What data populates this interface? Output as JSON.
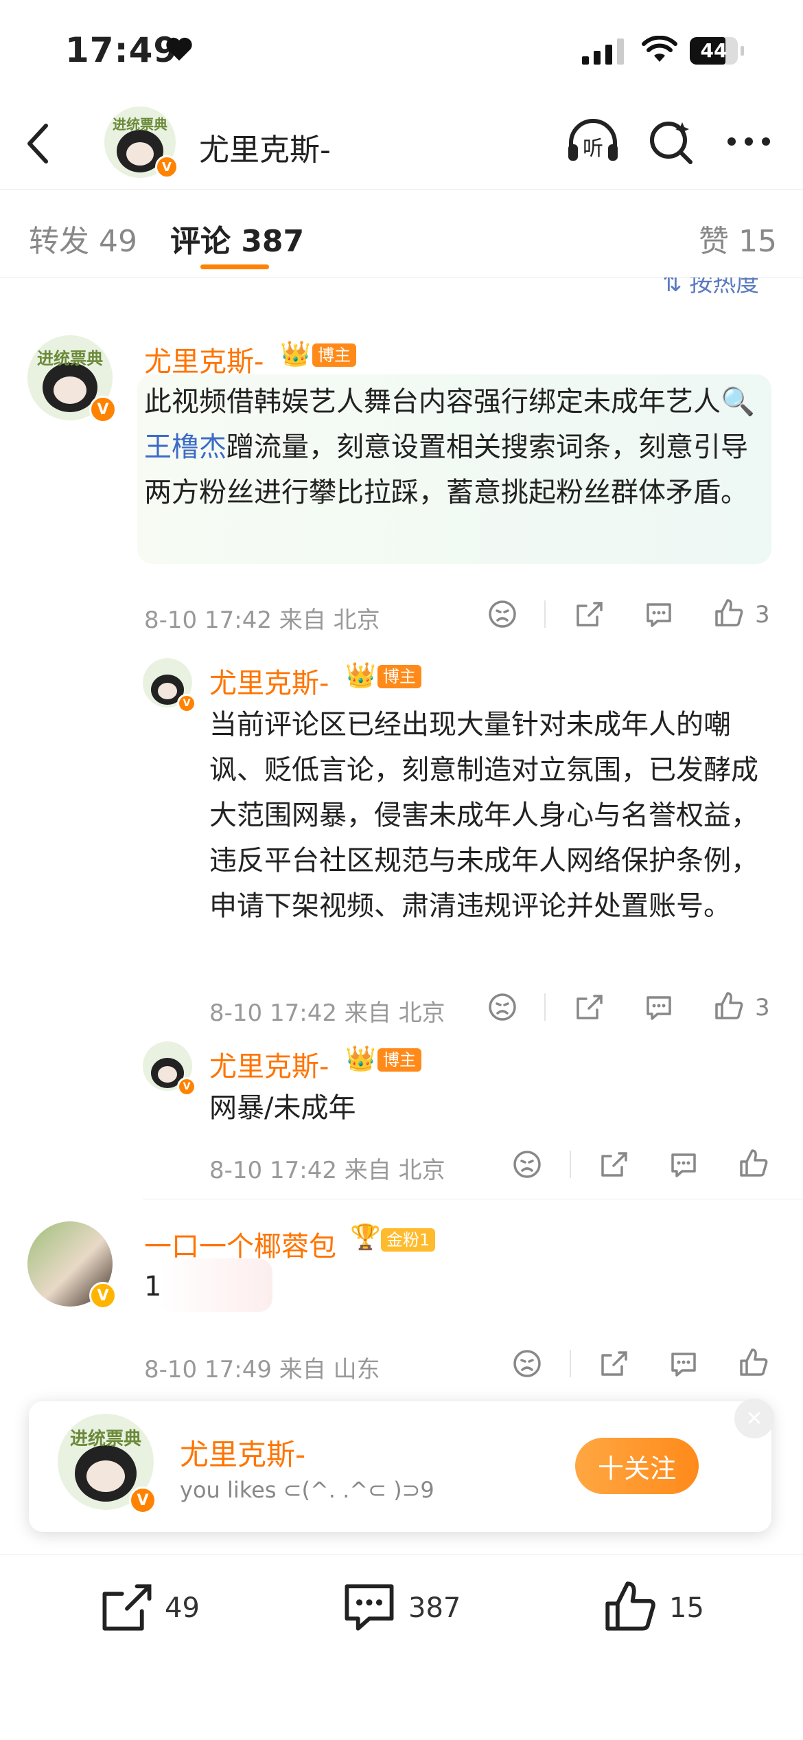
{
  "status_bar": {
    "time": "17:49",
    "battery": "44"
  },
  "header": {
    "username": "尤里克斯-",
    "avatar_text": "进统票典",
    "listen_label": "听"
  },
  "tabs": [
    {
      "label": "转发 49"
    },
    {
      "label": "评论 387"
    },
    {
      "label": "赞 15"
    }
  ],
  "sort_label": "按热度",
  "comments": [
    {
      "name": "尤里克斯-",
      "tag": "博主",
      "text_before": "此视频借韩娱艺人舞台内容强行绑定未成年艺人",
      "topic": "王橹杰",
      "text_after": "蹭流量，刻意设置相关搜索词条，刻意引导两方粉丝进行攀比拉踩，蓄意挑起粉丝群体矛盾。",
      "meta": "8-10 17:42 来自 北京",
      "likes": "3"
    },
    {
      "name": "尤里克斯-",
      "tag": "博主",
      "text": "当前评论区已经出现大量针对未成年人的嘲讽、贬低言论，刻意制造对立氛围，已发酵成大范围网暴，侵害未成年人身心与名誉权益，违反平台社区规范与未成年人网络保护条例，申请下架视频、肃清违规评论并处置账号。",
      "meta": "8-10 17:42 来自 北京",
      "likes": "3"
    },
    {
      "name": "尤里克斯-",
      "tag": "博主",
      "text": "网暴/未成年",
      "meta": "8-10 17:42 来自 北京",
      "likes": ""
    },
    {
      "name": "一口一个椰蓉包",
      "tag": "金粉1",
      "text": "1",
      "meta": "8-10 17:49 来自 山东",
      "likes": ""
    }
  ],
  "follow_card": {
    "name": "尤里克斯-",
    "subtitle": "you likes ⊂(^. .^⊂ )⊃9",
    "button": "十关注"
  },
  "bottom_bar": {
    "reposts": "49",
    "comments": "387",
    "likes": "15"
  },
  "colors": {
    "accent": "#ff8200",
    "name": "#ff7400",
    "link": "#3b6bc6"
  }
}
